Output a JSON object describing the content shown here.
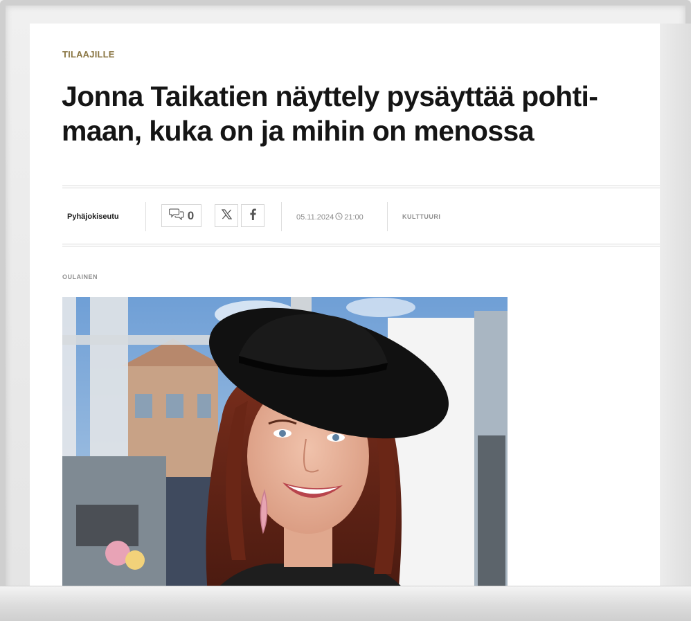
{
  "article": {
    "kicker": "TILAAJILLE",
    "headline": "Jonna Taikatien näyttely pysäyttää pohti­maan, kuka on ja mihin on menossa",
    "publisher": "Pyhäjokiseutu",
    "comment_count": "0",
    "date": "05.11.2024",
    "time": "21:00",
    "category": "KULTTUURI",
    "location": "OULAINEN"
  },
  "icons": {
    "comment": "comment-bubbles-icon",
    "x": "x-logo-icon",
    "facebook": "facebook-icon",
    "clock": "clock-icon"
  },
  "colors": {
    "kicker": "#8a7643",
    "headline": "#151515",
    "meta_text": "#8a8a8a"
  }
}
